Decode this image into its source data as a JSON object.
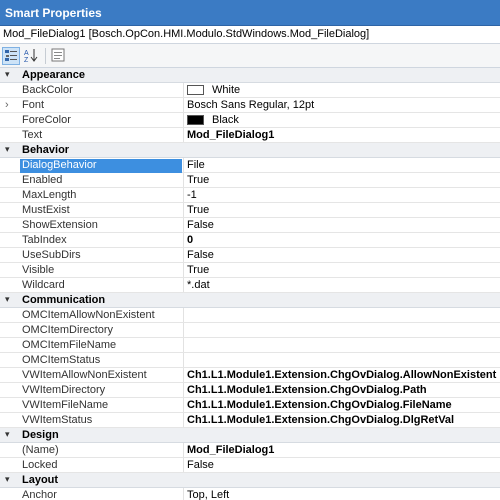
{
  "window": {
    "title": "Smart Properties"
  },
  "selector": {
    "text": "Mod_FileDialog1 [Bosch.OpCon.HMI.Modulo.StdWindows.Mod_FileDialog]"
  },
  "toolbar": {
    "buttons": [
      {
        "name": "categorized-view-button",
        "icon": "categorized-icon",
        "active": true
      },
      {
        "name": "alphabetical-sort-button",
        "icon": "sort-az-icon",
        "active": false
      },
      {
        "name": "property-pages-button",
        "icon": "property-pages-icon",
        "active": false
      }
    ]
  },
  "colors": {
    "titlebar": "#3b7bc4",
    "selection": "#3d8fe0",
    "category_bg": "#eef0f3",
    "white_swatch": "#ffffff",
    "black_swatch": "#000000"
  },
  "grid": [
    {
      "kind": "category",
      "label": "Appearance",
      "expander": "▾"
    },
    {
      "kind": "prop",
      "name": "BackColor",
      "value": "White",
      "swatch": "#ffffff"
    },
    {
      "kind": "prop",
      "name": "Font",
      "value": "Bosch Sans Regular, 12pt",
      "expander": "›"
    },
    {
      "kind": "prop",
      "name": "ForeColor",
      "value": "Black",
      "swatch": "#000000"
    },
    {
      "kind": "prop",
      "name": "Text",
      "value": "Mod_FileDialog1",
      "bold": true
    },
    {
      "kind": "category",
      "label": "Behavior",
      "expander": "▾"
    },
    {
      "kind": "prop",
      "name": "DialogBehavior",
      "value": "File",
      "selected": true
    },
    {
      "kind": "prop",
      "name": "Enabled",
      "value": "True"
    },
    {
      "kind": "prop",
      "name": "MaxLength",
      "value": "-1"
    },
    {
      "kind": "prop",
      "name": "MustExist",
      "value": "True"
    },
    {
      "kind": "prop",
      "name": "ShowExtension",
      "value": "False"
    },
    {
      "kind": "prop",
      "name": "TabIndex",
      "value": "0",
      "bold": true
    },
    {
      "kind": "prop",
      "name": "UseSubDirs",
      "value": "False"
    },
    {
      "kind": "prop",
      "name": "Visible",
      "value": "True"
    },
    {
      "kind": "prop",
      "name": "Wildcard",
      "value": "*.dat"
    },
    {
      "kind": "category",
      "label": "Communication",
      "expander": "▾"
    },
    {
      "kind": "prop",
      "name": "OMCItemAllowNonExistent",
      "value": ""
    },
    {
      "kind": "prop",
      "name": "OMCItemDirectory",
      "value": ""
    },
    {
      "kind": "prop",
      "name": "OMCItemFileName",
      "value": ""
    },
    {
      "kind": "prop",
      "name": "OMCItemStatus",
      "value": ""
    },
    {
      "kind": "prop",
      "name": "VWItemAllowNonExistent",
      "value": "Ch1.L1.Module1.Extension.ChgOvDialog.AllowNonExistent",
      "bold": true
    },
    {
      "kind": "prop",
      "name": "VWItemDirectory",
      "value": "Ch1.L1.Module1.Extension.ChgOvDialog.Path",
      "bold": true
    },
    {
      "kind": "prop",
      "name": "VWItemFileName",
      "value": "Ch1.L1.Module1.Extension.ChgOvDialog.FileName",
      "bold": true
    },
    {
      "kind": "prop",
      "name": "VWItemStatus",
      "value": "Ch1.L1.Module1.Extension.ChgOvDialog.DlgRetVal",
      "bold": true
    },
    {
      "kind": "category",
      "label": "Design",
      "expander": "▾"
    },
    {
      "kind": "prop",
      "name": "(Name)",
      "value": "Mod_FileDialog1",
      "bold": true
    },
    {
      "kind": "prop",
      "name": "Locked",
      "value": "False"
    },
    {
      "kind": "category",
      "label": "Layout",
      "expander": "▾"
    },
    {
      "kind": "prop",
      "name": "Anchor",
      "value": "Top, Left"
    }
  ]
}
